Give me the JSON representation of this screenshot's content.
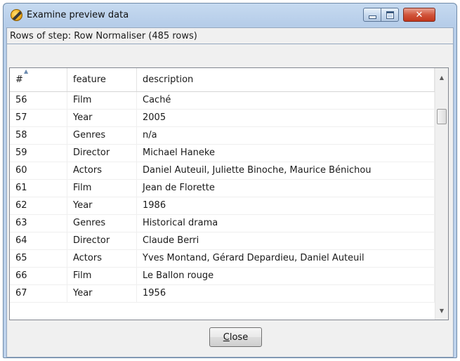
{
  "window": {
    "title": "Examine preview data",
    "minimize_icon": "minimize-icon",
    "maximize_icon": "maximize-icon",
    "close_icon": "close-icon",
    "close_glyph": "✕"
  },
  "rows_label": "Rows of step: Row Normaliser (485 rows)",
  "grid": {
    "columns": [
      "#",
      "feature",
      "description"
    ],
    "sort_indicator": "ascending",
    "rows": [
      [
        "56",
        "Film",
        "Caché"
      ],
      [
        "57",
        "Year",
        "2005"
      ],
      [
        "58",
        "Genres",
        "n/a"
      ],
      [
        "59",
        "Director",
        "Michael Haneke"
      ],
      [
        "60",
        "Actors",
        "Daniel Auteuil, Juliette Binoche, Maurice Bénichou"
      ],
      [
        "61",
        "Film",
        "Jean de Florette"
      ],
      [
        "62",
        "Year",
        "1986"
      ],
      [
        "63",
        "Genres",
        "Historical drama"
      ],
      [
        "64",
        "Director",
        "Claude Berri"
      ],
      [
        "65",
        "Actors",
        "Yves Montand, Gérard Depardieu, Daniel Auteuil"
      ],
      [
        "66",
        "Film",
        "Le Ballon rouge"
      ],
      [
        "67",
        "Year",
        "1956"
      ]
    ]
  },
  "footer": {
    "close_mnemonic": "C",
    "close_rest": "lose"
  }
}
